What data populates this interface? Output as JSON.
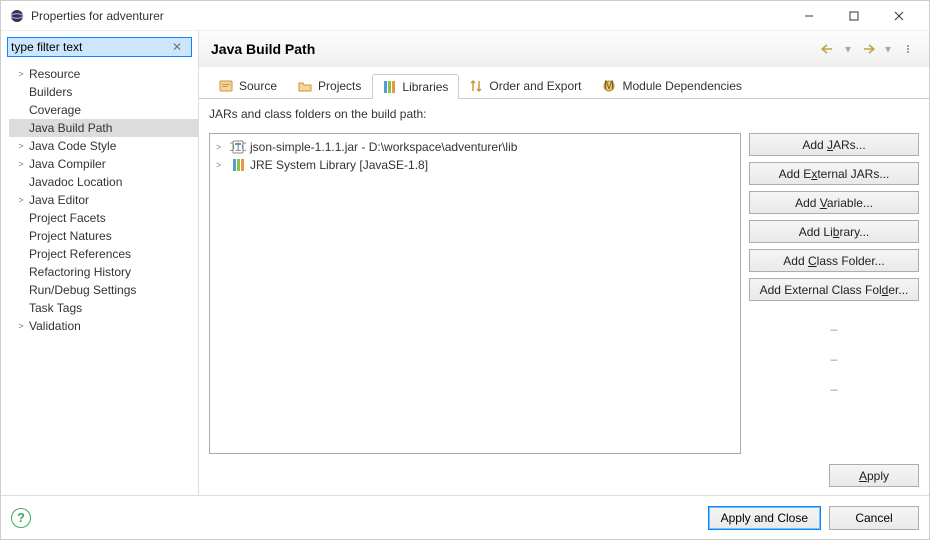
{
  "window": {
    "title": "Properties for adventurer"
  },
  "sidebar": {
    "filter_placeholder": "type filter text",
    "items": [
      {
        "label": "Resource",
        "expandable": true
      },
      {
        "label": "Builders",
        "expandable": false
      },
      {
        "label": "Coverage",
        "expandable": false
      },
      {
        "label": "Java Build Path",
        "expandable": false,
        "selected": true
      },
      {
        "label": "Java Code Style",
        "expandable": true
      },
      {
        "label": "Java Compiler",
        "expandable": true
      },
      {
        "label": "Javadoc Location",
        "expandable": false
      },
      {
        "label": "Java Editor",
        "expandable": true
      },
      {
        "label": "Project Facets",
        "expandable": false
      },
      {
        "label": "Project Natures",
        "expandable": false
      },
      {
        "label": "Project References",
        "expandable": false
      },
      {
        "label": "Refactoring History",
        "expandable": false
      },
      {
        "label": "Run/Debug Settings",
        "expandable": false
      },
      {
        "label": "Task Tags",
        "expandable": false
      },
      {
        "label": "Validation",
        "expandable": true
      }
    ]
  },
  "header": {
    "title": "Java Build Path"
  },
  "tabs": [
    {
      "label": "Source"
    },
    {
      "label": "Projects"
    },
    {
      "label": "Libraries",
      "active": true
    },
    {
      "label": "Order and Export"
    },
    {
      "label": "Module Dependencies"
    }
  ],
  "libraries": {
    "caption": "JARs and class folders on the build path:",
    "items": [
      {
        "label": "json-simple-1.1.1.jar - D:\\workspace\\adventurer\\lib",
        "icon": "jar"
      },
      {
        "label": "JRE System Library [JavaSE-1.8]",
        "icon": "lib"
      }
    ]
  },
  "buttons": {
    "add_jars": "Add JARs...",
    "add_ext_jars": "Add External JARs...",
    "add_var": "Add Variable...",
    "add_lib": "Add Library...",
    "add_class_folder": "Add Class Folder...",
    "add_ext_class_folder": "Add External Class Folder...",
    "apply": "Apply",
    "apply_close": "Apply and Close",
    "cancel": "Cancel"
  }
}
